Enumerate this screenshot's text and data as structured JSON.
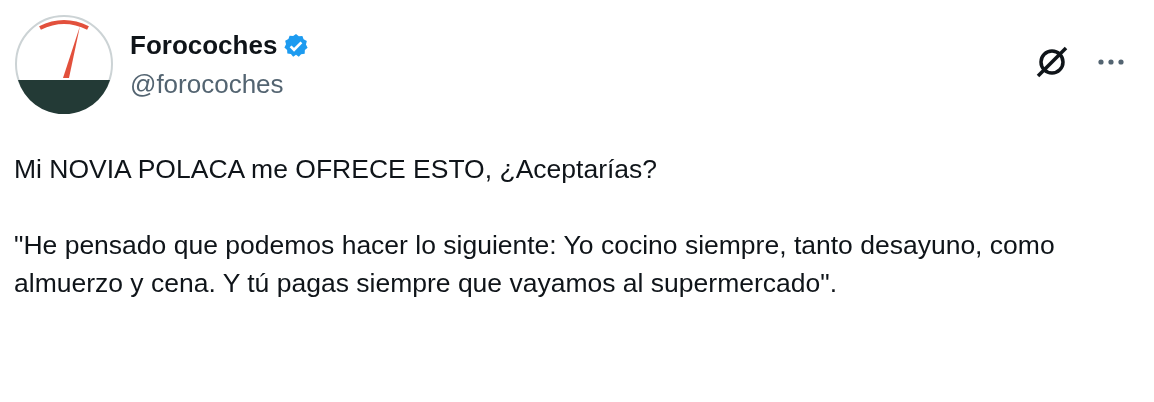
{
  "author": {
    "name": "Forocoches",
    "verified": true,
    "handle": "@forocoches"
  },
  "paragraphs": [
    "Mi NOVIA POLACA me OFRECE ESTO, ¿Aceptarías?",
    "\"He pensado que podemos hacer lo siguiente: Yo cocino siempre, tanto desayuno, como almuerzo y cena. Y tú pagas siempre que vayamos al supermercado\"."
  ]
}
